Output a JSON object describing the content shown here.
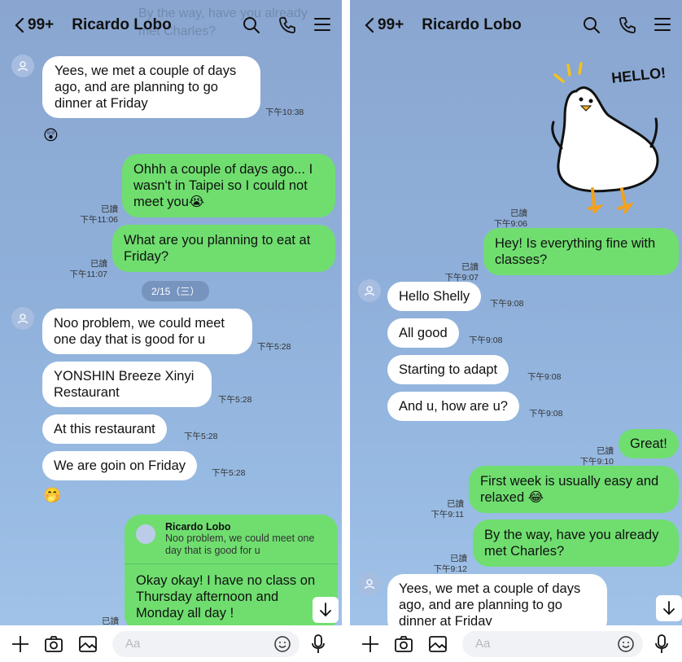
{
  "header": {
    "back_count": "99+",
    "title": "Ricardo Lobo"
  },
  "left": {
    "ghost_line1": "By the way, have you already",
    "ghost_line2": "met Charles?",
    "messages": [
      {
        "text": "Yees, we met a couple of days\nago, and are planning to go\ndinner at Friday",
        "time": "下午10:38"
      },
      {
        "text": "Ohhh a couple of days ago... I\nwasn't in Taipei so I could not\nmeet you",
        "emoji": "😭",
        "read": "已讀",
        "time": "下午11:06"
      },
      {
        "text": "What are you planning to eat at\nFriday?",
        "read": "已讀",
        "time": "下午11:07"
      },
      {
        "text": "Noo problem, we could meet\none day that is good for u",
        "time": "下午5:28"
      },
      {
        "text": "YONSHIN Breeze Xinyi\nRestaurant",
        "time": "下午5:28"
      },
      {
        "text": "At this restaurant",
        "time": "下午5:28"
      },
      {
        "text": "We are goin on Friday",
        "time": "下午5:28"
      }
    ],
    "reaction1": "😲",
    "reaction2": "🤭",
    "date_pill": "2/15（三）",
    "reply": {
      "quote_name": "Ricardo Lobo",
      "quote_text": "Noo problem, we could meet one\nday that is good for u",
      "text": "Okay okay! I have no class on\nThursday afternoon and\nMonday all day !",
      "read": "已讀"
    }
  },
  "right": {
    "sticker_text": "HELLO!",
    "sticker_read": "已讀",
    "sticker_time": "下午9:06",
    "messages": [
      {
        "text": "Hey! Is everything fine with\nclasses?",
        "read": "已讀",
        "time": "下午9:07"
      },
      {
        "text": "Hello Shelly",
        "time": "下午9:08"
      },
      {
        "text": "All good",
        "time": "下午9:08"
      },
      {
        "text": "Starting to adapt",
        "time": "下午9:08"
      },
      {
        "text": "And u, how are u?",
        "time": "下午9:08"
      },
      {
        "text": "Great!",
        "read": "已讀",
        "time": "下午9:10"
      },
      {
        "text": "First week is usually easy and\nrelaxed",
        "emoji": "😂",
        "read": "已讀",
        "time": "下午9:11"
      },
      {
        "text": "By the way, have you already\nmet Charles?",
        "read": "已讀",
        "time": "下午9:12"
      },
      {
        "text": "Yees, we met a couple of days\nago, and are planning to go\ndinner at Friday"
      }
    ]
  },
  "input": {
    "placeholder": "Aa"
  }
}
